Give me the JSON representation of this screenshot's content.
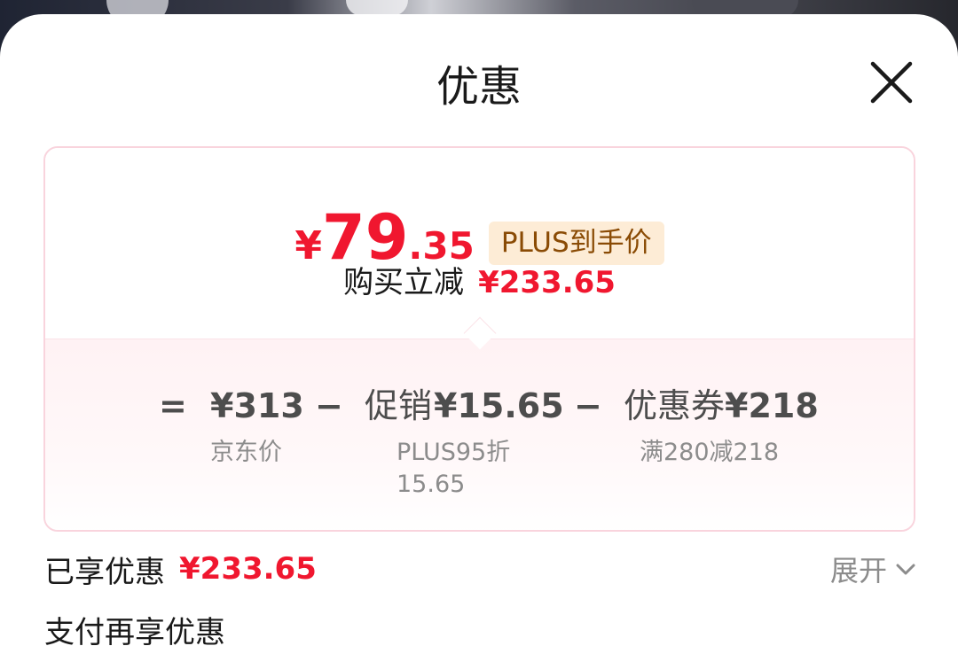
{
  "sheet": {
    "title": "优惠",
    "close_icon": "close-icon"
  },
  "summary": {
    "currency": "¥",
    "price_int": "79",
    "price_dec": ".35",
    "tag": "PLUS到手价",
    "saving_label": "购买立减",
    "saving_amount": "¥233.65"
  },
  "breakdown": {
    "equals": "=",
    "base_price": "¥313",
    "base_price_note": "京东价",
    "minus1": "−",
    "promo_label": "促销",
    "promo_amount": "¥15.65",
    "promo_note_line1": "PLUS95折",
    "promo_note_line2": "15.65",
    "minus2": "−",
    "coupon_label": "优惠券",
    "coupon_amount": "¥218",
    "coupon_note": "满280减218"
  },
  "enjoyed": {
    "label": "已享优惠",
    "amount": "¥233.65",
    "expand_label": "展开"
  },
  "pay_more": {
    "label": "支付再享优惠"
  },
  "colors": {
    "accent_red": "#f0172f",
    "tag_bg": "#fdecd6",
    "tag_text": "#8a4b05",
    "card_border": "#f9d4dd"
  }
}
